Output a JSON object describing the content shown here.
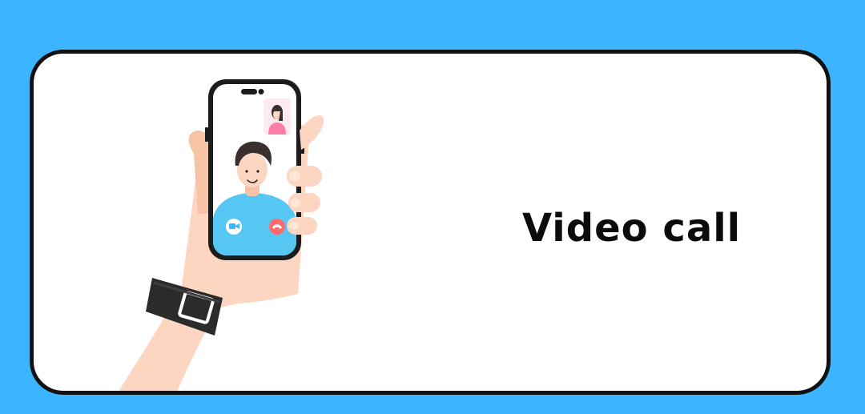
{
  "colors": {
    "background": "#3cb4fe",
    "card": "#ffffff",
    "border": "#111111",
    "skin": "#fcd6c0",
    "shirt": "#56c6f2",
    "end_call": "#ff6b6b",
    "hair": "#3a2f2f",
    "watch": "#2b2b2b"
  },
  "icons": {
    "video": "video-camera-icon",
    "end_call": "phone-hangup-icon"
  },
  "card": {
    "title": "Video call"
  }
}
